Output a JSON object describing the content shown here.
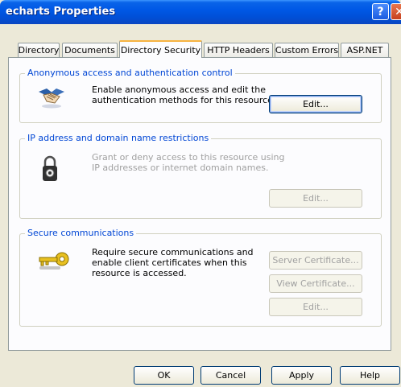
{
  "window": {
    "title": "echarts Properties",
    "help_glyph": "?",
    "close_glyph": "✕"
  },
  "tabs": [
    {
      "label": "Directory"
    },
    {
      "label": "Documents"
    },
    {
      "label": "Directory Security"
    },
    {
      "label": "HTTP Headers"
    },
    {
      "label": "Custom Errors"
    },
    {
      "label": "ASP.NET"
    }
  ],
  "active_tab": "Directory Security",
  "anonymous": {
    "legend": "Anonymous access and authentication control",
    "line1": "Enable anonymous access and edit the",
    "line2": "authentication methods for this resource.",
    "edit_label": "Edit..."
  },
  "ip": {
    "legend": "IP address and domain name restrictions",
    "line1": "Grant or deny access to this resource using",
    "line2": "IP addresses or internet domain names.",
    "edit_label": "Edit..."
  },
  "secure": {
    "legend": "Secure communications",
    "line1": "Require secure communications and",
    "line2": "enable client certificates when this",
    "line3": "resource is accessed.",
    "server_cert_label": "Server Certificate...",
    "view_cert_label": "View Certificate...",
    "edit_label": "Edit..."
  },
  "footer": {
    "ok_label": "OK",
    "cancel_label": "Cancel",
    "apply_label": "Apply",
    "help_label": "Help"
  },
  "icons": {
    "anonymous": "handshake-icon",
    "ip": "padlock-icon",
    "secure": "key-icon"
  },
  "colors": {
    "titlebar": "#0058e6",
    "legend": "#0046d5",
    "window_bg": "#ece9d8",
    "disabled_text": "#a0a0a0"
  }
}
